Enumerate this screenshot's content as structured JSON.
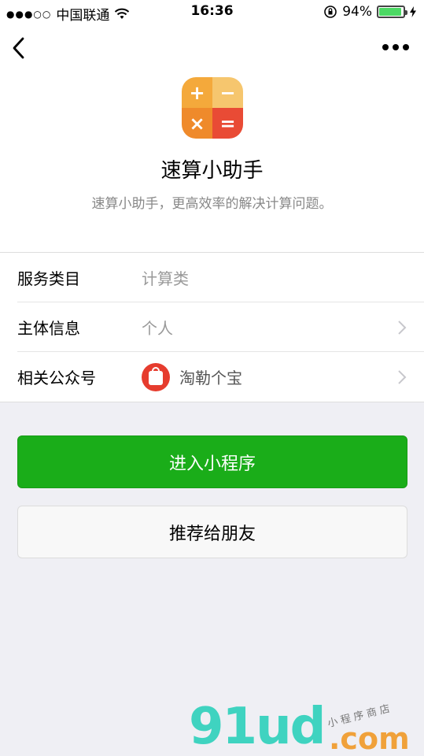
{
  "status_bar": {
    "signal": "●●●○○",
    "carrier": "中国联通",
    "time": "16:36",
    "battery_percent": "94%",
    "battery_level": 0.94
  },
  "app": {
    "name": "速算小助手",
    "description": "速算小助手，更高效率的解决计算问题。",
    "icon_symbols": [
      "+",
      "−",
      "×",
      "="
    ],
    "icon_colors": [
      "#f4a93b",
      "#f6c66e",
      "#ef8a2b",
      "#e94b35"
    ]
  },
  "info": {
    "category": {
      "label": "服务类目",
      "value": "计算类"
    },
    "subject": {
      "label": "主体信息",
      "value": "个人"
    },
    "account": {
      "label": "相关公众号",
      "value": "淘勒个宝"
    }
  },
  "buttons": {
    "enter": "进入小程序",
    "share": "推荐给朋友"
  },
  "watermark": {
    "logo_text": "91ud",
    "domain": ".com",
    "tagline": "小程序商店"
  },
  "colors": {
    "primary_green": "#1aad19",
    "background": "#efeff4"
  }
}
